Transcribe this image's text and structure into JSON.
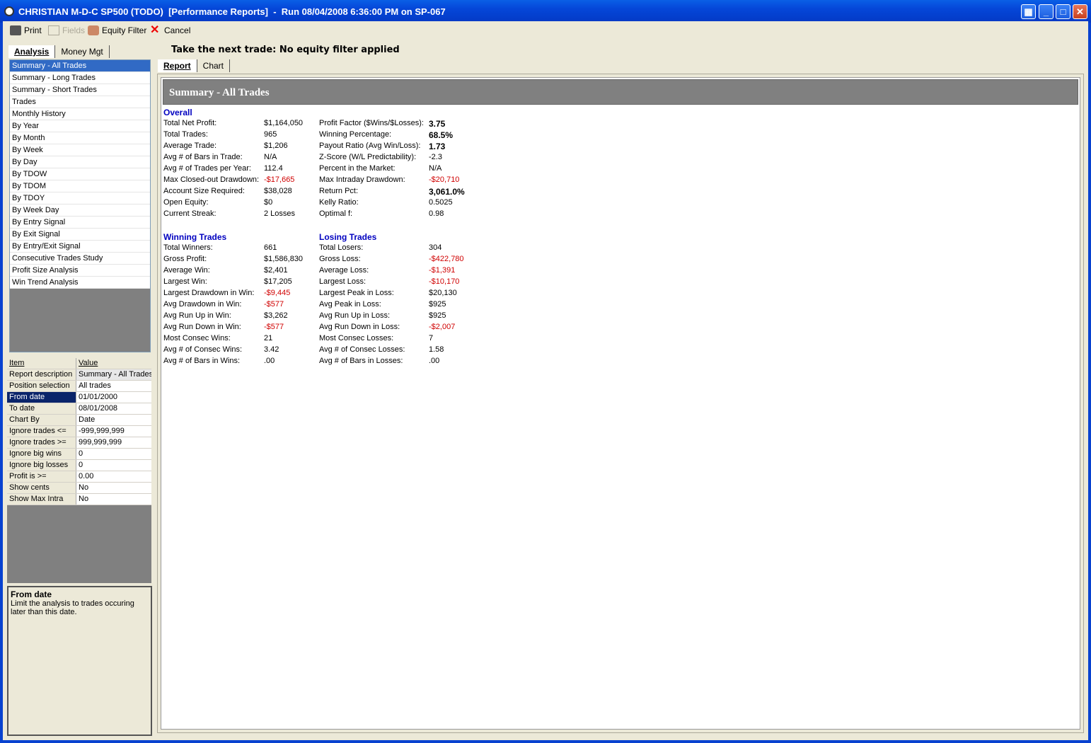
{
  "title": "CHRISTIAN M-D-C SP500 (TODO)  [Performance Reports]  -  Run 08/04/2008 6:36:00 PM on SP-067",
  "toolbar": {
    "print": "Print",
    "fields": "Fields",
    "equity_filter": "Equity Filter",
    "cancel": "Cancel"
  },
  "left_tabs": [
    "Analysis",
    "Money Mgt"
  ],
  "heading": "Take the next trade: No equity filter applied",
  "report_tabs": [
    "Report",
    "Chart"
  ],
  "nav_items": [
    "Summary - All Trades",
    "Summary - Long Trades",
    "Summary - Short Trades",
    "Trades",
    "Monthly History",
    "By Year",
    "By Month",
    "By Week",
    "By Day",
    "By TDOW",
    "By TDOM",
    "By TDOY",
    "By Week Day",
    "By Entry Signal",
    "By Exit Signal",
    "By Entry/Exit Signal",
    "Consecutive Trades Study",
    "Profit Size Analysis",
    "Win Trend Analysis"
  ],
  "selected_nav": "Summary - All Trades",
  "grid": {
    "headers": [
      "Item",
      "Value"
    ],
    "rows": [
      [
        "Report description",
        "Summary - All Trades"
      ],
      [
        "Position selection",
        "All trades"
      ],
      [
        "From date",
        "01/01/2000"
      ],
      [
        "To date",
        "08/01/2008"
      ],
      [
        "Chart By",
        "Date"
      ],
      [
        "Ignore trades <=",
        "-999,999,999"
      ],
      [
        "Ignore trades >=",
        "999,999,999"
      ],
      [
        "Ignore big wins",
        "0"
      ],
      [
        "Ignore big losses",
        "0"
      ],
      [
        "Profit is >=",
        "0.00"
      ],
      [
        "Show cents",
        "No"
      ],
      [
        "Show Max Intra",
        "No"
      ]
    ]
  },
  "help": {
    "title": "From date",
    "text": "Limit the analysis to trades occuring later than this date."
  },
  "summary_title": "Summary - All Trades",
  "colors": {
    "section": "#0000c0",
    "negative": "#d00000",
    "selection": "#316ac5"
  },
  "sections": [
    {
      "left_title": "Overall",
      "right_title": "",
      "rows": [
        [
          "Total Net Profit:",
          "$1,164,050",
          "",
          "Profit Factor ($Wins/$Losses):",
          "3.75",
          "b"
        ],
        [
          "Total Trades:",
          "965",
          "",
          "Winning Percentage:",
          "68.5%",
          "b"
        ],
        [
          "Average Trade:",
          "$1,206",
          "",
          "Payout Ratio (Avg Win/Loss):",
          "1.73",
          "b"
        ],
        [
          "Avg # of Bars in Trade:",
          "N/A",
          "",
          "Z-Score (W/L Predictability):",
          "-2.3",
          ""
        ],
        [
          "Avg # of Trades per Year:",
          "112.4",
          "",
          "Percent in the Market:",
          "N/A",
          ""
        ],
        [
          "Max Closed-out Drawdown:",
          "-$17,665",
          "n",
          "Max Intraday Drawdown:",
          "-$20,710",
          "n"
        ],
        [
          "Account Size Required:",
          "$38,028",
          "",
          "Return Pct:",
          "3,061.0%",
          "b"
        ],
        [
          "Open Equity:",
          "$0",
          "",
          "Kelly Ratio:",
          "0.5025",
          ""
        ],
        [
          "Current Streak:",
          "2 Losses",
          "",
          "Optimal f:",
          "0.98",
          ""
        ]
      ]
    },
    {
      "left_title": "Winning Trades",
      "right_title": "Losing Trades",
      "rows": [
        [
          "Total Winners:",
          "661",
          "",
          "Total Losers:",
          "304",
          ""
        ],
        [
          "Gross Profit:",
          "$1,586,830",
          "",
          "Gross Loss:",
          "-$422,780",
          "n"
        ],
        [
          "Average Win:",
          "$2,401",
          "",
          "Average Loss:",
          "-$1,391",
          "n"
        ],
        [
          "Largest Win:",
          "$17,205",
          "",
          "Largest Loss:",
          "-$10,170",
          "n"
        ],
        [
          "Largest Drawdown in Win:",
          "-$9,445",
          "n",
          "Largest Peak in Loss:",
          "$20,130",
          ""
        ],
        [
          "Avg Drawdown in Win:",
          "-$577",
          "n",
          "Avg Peak in Loss:",
          "$925",
          ""
        ],
        [
          "Avg Run Up in Win:",
          "$3,262",
          "",
          "Avg Run Up in Loss:",
          "$925",
          ""
        ],
        [
          "Avg Run Down in Win:",
          "-$577",
          "n",
          "Avg Run Down in Loss:",
          "-$2,007",
          "n"
        ],
        [
          "Most Consec Wins:",
          "21",
          "",
          "Most Consec Losses:",
          "7",
          ""
        ],
        [
          "Avg # of Consec Wins:",
          "3.42",
          "",
          "Avg # of Consec Losses:",
          "1.58",
          ""
        ],
        [
          "Avg # of Bars in Wins:",
          ".00",
          "",
          "Avg # of Bars in Losses:",
          ".00",
          ""
        ]
      ]
    }
  ]
}
